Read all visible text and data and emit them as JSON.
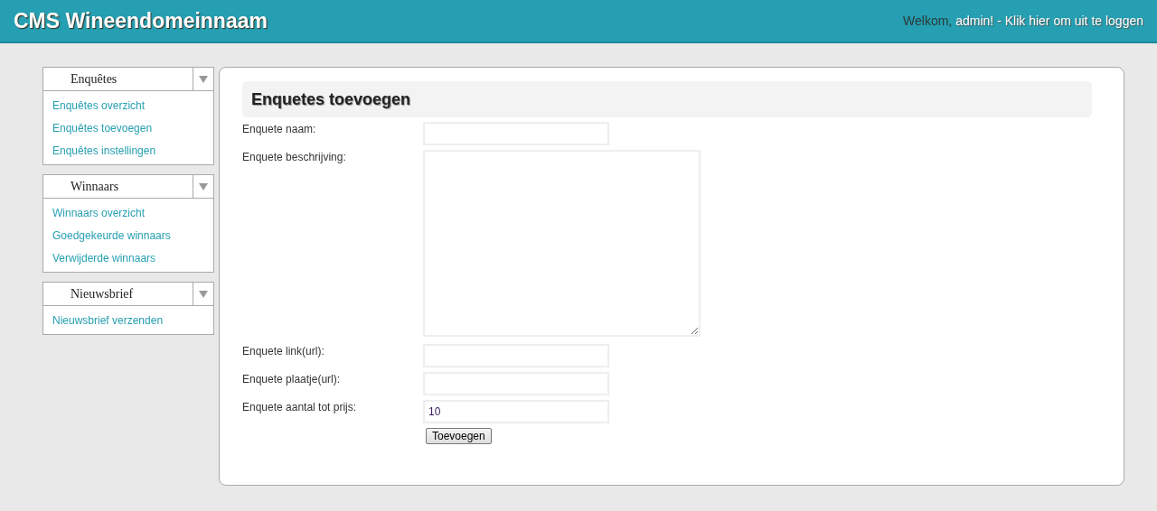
{
  "header": {
    "title": "CMS Wineendomeinnaam",
    "greeting": "Welkom,",
    "logout_link": "admin! - Klik hier om uit te loggen"
  },
  "sidebar": [
    {
      "title": "Enquêtes",
      "expanded": true,
      "items": [
        "Enquêtes overzicht",
        "Enquêtes toevoegen",
        "Enquêtes instellingen"
      ]
    },
    {
      "title": "Winnaars",
      "expanded": true,
      "items": [
        "Winnaars overzicht",
        "Goedgekeurde winnaars",
        "Verwijderde winnaars"
      ]
    },
    {
      "title": "Nieuwsbrief",
      "expanded": true,
      "items": [
        "Nieuwsbrief verzenden"
      ]
    }
  ],
  "form": {
    "title": "Enquetes toevoegen",
    "fields": [
      {
        "label": "Enquete naam:",
        "kind": "text"
      },
      {
        "label": "Enquete beschrijving:",
        "kind": "textarea"
      },
      {
        "label": "Enquete link(url):",
        "kind": "text"
      },
      {
        "label": "Enquete plaatje(url):",
        "kind": "text"
      },
      {
        "label": "Enquete aantal tot prijs:",
        "kind": "text",
        "value": "10"
      }
    ],
    "submit": "Toevoegen"
  }
}
